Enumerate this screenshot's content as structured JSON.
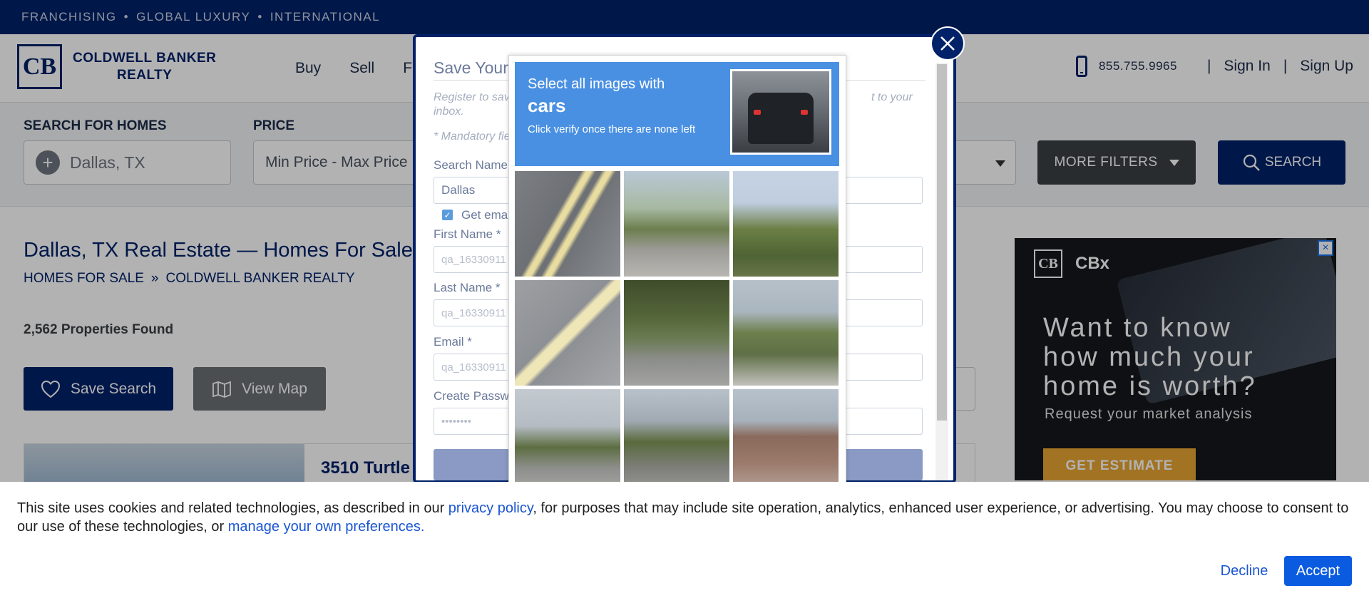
{
  "topbar": {
    "items": [
      "FRANCHISING",
      "GLOBAL LUXURY",
      "INTERNATIONAL"
    ],
    "separator": "•"
  },
  "header": {
    "logo_mark": "CB",
    "logo_line1": "COLDWELL BANKER",
    "logo_line2": "REALTY",
    "nav": [
      "Buy",
      "Sell",
      "F"
    ],
    "phone": "855.755.9965",
    "sign_in": "Sign In",
    "sign_up": "Sign Up",
    "divider": "|"
  },
  "search": {
    "homes_label": "SEARCH FOR HOMES",
    "location_value": "Dallas, TX",
    "price_label": "PRICE",
    "price_value": "Min Price  -  Max Price",
    "more_filters": "MORE FILTERS",
    "search_button": "SEARCH"
  },
  "results": {
    "heading": "Dallas, TX Real Estate — Homes For Sale",
    "breadcrumb": [
      "HOMES FOR SALE",
      "COLDWELL BANKER REALTY"
    ],
    "breadcrumb_sep": "»",
    "count": "2,562 Properties Found",
    "save_search": "Save Search",
    "view_map": "View Map",
    "listing_address": "3510 Turtle"
  },
  "ad": {
    "logo_mark": "CB",
    "brand": "CBx",
    "headline_lines": [
      "Want to know",
      "how much your",
      "home is worth?"
    ],
    "subtext": "Request your market analysis",
    "cta": "GET ESTIMATE",
    "close": "×"
  },
  "modal": {
    "title": "Save Your",
    "desc_start": "Register to sav",
    "desc_tail": "t to your",
    "desc_line2": "inbox.",
    "mandatory": "* Mandatory fie",
    "search_name_label": "Search Name",
    "search_name_value": "Dallas",
    "get_email_label": "Get ema",
    "first_name_label": "First Name *",
    "first_name_value": "qa_16330911",
    "last_name_label": "Last Name *",
    "last_name_value": "qa_16330911",
    "email_label": "Email *",
    "email_value": "qa_16330911",
    "password_label": "Create Passw",
    "password_value": "••••••••"
  },
  "captcha": {
    "line1": "Select all images with",
    "target": "cars",
    "line3": "Click verify once there are none left",
    "tiles": [
      {
        "name": "road-stripes-tile",
        "bg": "linear-gradient(120deg,#7c7f83 0%,#6d7074 40%,#e8dca0 43%,#e8dca0 46%,#6d7074 49%,#6d7074 52%,#e8dca0 55%,#e8dca0 58%,#707377 61%,#8a8d91 100%)"
      },
      {
        "name": "street-trees-tile",
        "bg": "linear-gradient(180deg,#b9c8d6 0%,#a7b9a2 35%,#6c7e4e 55%,#9d9c98 75%,#b7b6b1 100%)"
      },
      {
        "name": "traffic-light-tile",
        "bg": "linear-gradient(180deg,#c6d3e3 0%,#bfcde0 30%,#6b7f45 55%,#4f6334 80%,#667548 100%)"
      },
      {
        "name": "road-line-tile",
        "bg": "linear-gradient(135deg,#9d9fa3 0%,#8d9094 45%,#efe6b8 48%,#efe6b8 54%,#8d9094 57%,#a5a7aa 100%)"
      },
      {
        "name": "tree-parked-car-tile",
        "bg": "linear-gradient(180deg,#3f4c2b 0%,#55663a 35%,#6a7a52 55%,#8b8d8a 75%,#a3a3a0 100%)"
      },
      {
        "name": "bridge-road-tile",
        "bg": "linear-gradient(180deg,#b6c0c9 0%,#aab6bf 30%,#6c7f4c 50%,#5f6f46 70%,#c2c1bc 100%)"
      },
      {
        "name": "highway-cars-tile",
        "bg": "linear-gradient(180deg,#c3c9cf 0%,#b5bcc3 35%,#5d6e42 55%,#8e8f8c 75%,#a9a9a6 100%)"
      },
      {
        "name": "street-car-tile",
        "bg": "linear-gradient(180deg,#b8c1ca 0%,#a1aab3 30%,#5a6a3d 50%,#7e7f7b 75%,#9b9b97 100%)"
      },
      {
        "name": "house-roof-tile",
        "bg": "linear-gradient(180deg,#b8c2cc 0%,#a7b1bb 30%,#8a6a5c 45%,#9b7a6b 70%,#b9a9a0 100%)"
      }
    ]
  },
  "cookie": {
    "text_before_privacy": "This site uses cookies and related technologies, as described in our ",
    "privacy_link": "privacy policy",
    "text_middle": ", for purposes that may include site operation, analytics, enhanced user experience, or advertising. You may choose to consent to our use of these technologies, or ",
    "preferences_link": "manage your own preferences.",
    "decline": "Decline",
    "accept": "Accept"
  }
}
